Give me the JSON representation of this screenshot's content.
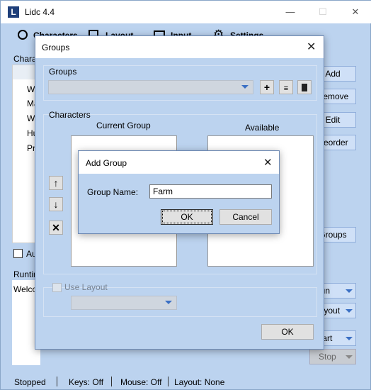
{
  "app": {
    "title": "Lidc 4.4",
    "tabs": [
      {
        "label": "Characters",
        "icon": "user-icon"
      },
      {
        "label": "Layout",
        "icon": "window-icon"
      },
      {
        "label": "Input",
        "icon": "keyboard-icon"
      },
      {
        "label": "Settings",
        "icon": "gear-icon"
      }
    ],
    "characters_group_label": "Characters",
    "character_items": [
      "Wa",
      "Ma",
      "Wa",
      "Hu",
      "Pri"
    ],
    "buttons": {
      "add": "Add",
      "remove": "Remove",
      "edit": "Edit",
      "reorder": "Reorder",
      "groups": "Groups"
    },
    "auto_label": "Auto",
    "runtime_label": "Runtime",
    "welcome_text": "Welcome",
    "run_label": "Run",
    "layout_label": "Layout",
    "start_label": "Start",
    "stop_label": "Stop",
    "status": {
      "state": "Stopped",
      "keys": "Keys: Off",
      "mouse": "Mouse: Off",
      "layout": "Layout: None"
    }
  },
  "groups_dialog": {
    "title": "Groups",
    "groups_section": "Groups",
    "characters_section": "Characters",
    "current_group_label": "Current Group",
    "available_label": "Available",
    "use_layout_label": "Use Layout",
    "ok_label": "OK"
  },
  "add_group_dialog": {
    "title": "Add Group",
    "field_label": "Group Name:",
    "field_value": "Farm",
    "ok_label": "OK",
    "cancel_label": "Cancel"
  }
}
